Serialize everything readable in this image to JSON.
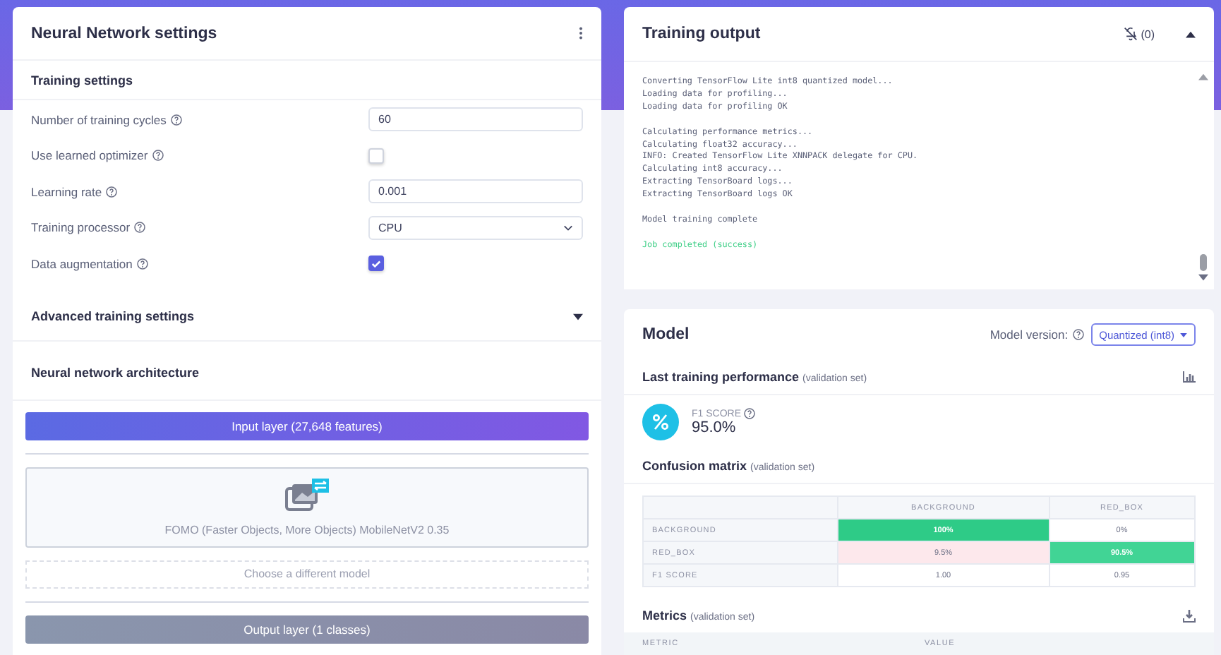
{
  "settings_panel": {
    "title": "Neural Network settings",
    "section": "Training settings",
    "fields": [
      {
        "kind": "text",
        "label": "Number of training cycles",
        "value": "60"
      },
      {
        "kind": "checkbox",
        "label": "Use learned optimizer",
        "checked": false
      },
      {
        "kind": "text",
        "label": "Learning rate",
        "value": "0.001"
      },
      {
        "kind": "select",
        "label": "Training processor",
        "value": "CPU"
      },
      {
        "kind": "checkbox",
        "label": "Data augmentation",
        "checked": true
      }
    ],
    "advanced": {
      "label": "Advanced training settings",
      "expanded": false
    },
    "architecture": {
      "title": "Neural network architecture",
      "input_layer": "Input layer (27,648 features)",
      "model": "FOMO (Faster Objects, More Objects) MobileNetV2 0.35",
      "choose": "Choose a different model",
      "output_layer": "Output layer (1 classes)"
    }
  },
  "training_output": {
    "title": "Training output",
    "notifications": "(0)",
    "expanded": true,
    "lines": [
      {
        "text": "Converting TensorFlow Lite int8 quantized model...",
        "kind": "log",
        "gap_before": false
      },
      {
        "text": "Loading data for profiling...",
        "kind": "log",
        "gap_before": false
      },
      {
        "text": "Loading data for profiling OK",
        "kind": "log",
        "gap_before": false
      },
      {
        "text": "Calculating performance metrics...",
        "kind": "log",
        "gap_before": true
      },
      {
        "text": "Calculating float32 accuracy...",
        "kind": "log",
        "gap_before": false
      },
      {
        "text": "INFO: Created TensorFlow Lite XNNPACK delegate for CPU.",
        "kind": "log",
        "gap_before": false
      },
      {
        "text": "Calculating int8 accuracy...",
        "kind": "log",
        "gap_before": false
      },
      {
        "text": "Extracting TensorBoard logs...",
        "kind": "log",
        "gap_before": false
      },
      {
        "text": "Extracting TensorBoard logs OK",
        "kind": "log",
        "gap_before": false
      },
      {
        "text": "Model training complete",
        "kind": "log",
        "gap_before": true
      },
      {
        "text": "Job completed (success)",
        "kind": "success",
        "gap_before": true
      }
    ]
  },
  "model_panel": {
    "title": "Model",
    "version_label": "Model version:",
    "version": "Quantized (int8)",
    "performance": {
      "title": "Last training performance",
      "note": "(validation set)",
      "metric_label": "F1 SCORE",
      "metric_value": "95.0%"
    },
    "confusion": {
      "title": "Confusion matrix",
      "note": "(validation set)",
      "columns": [
        "BACKGROUND",
        "RED_BOX"
      ],
      "rows": [
        {
          "label": "BACKGROUND",
          "cells": [
            {
              "text": "100%",
              "color": "#2ecb87"
            },
            {
              "text": "0%",
              "color": "#ffffff"
            }
          ]
        },
        {
          "label": "RED_BOX",
          "cells": [
            {
              "text": "9.5%",
              "color": "#fde8ec"
            },
            {
              "text": "90.5%",
              "color": "#41d495"
            }
          ]
        },
        {
          "label": "F1 SCORE",
          "cells": [
            {
              "text": "1.00",
              "color": "#ffffff"
            },
            {
              "text": "0.95",
              "color": "#ffffff"
            }
          ]
        }
      ]
    },
    "metrics": {
      "title": "Metrics",
      "note": "(validation set)",
      "columns": [
        "METRIC",
        "VALUE"
      ]
    }
  }
}
